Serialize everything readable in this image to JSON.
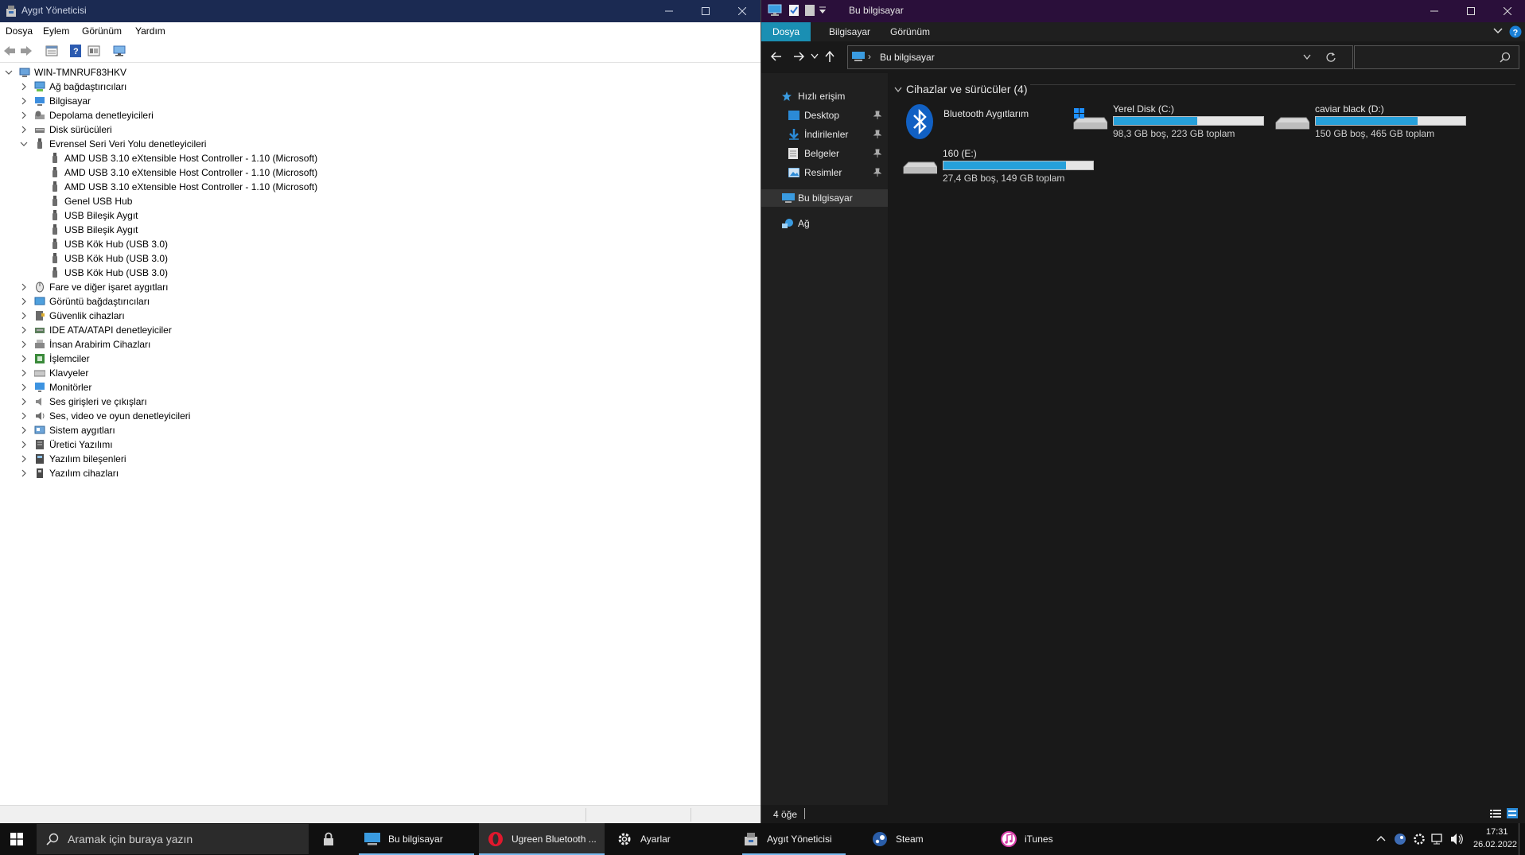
{
  "device_manager": {
    "title": "Aygıt Yöneticisi",
    "menu": [
      "Dosya",
      "Eylem",
      "Görünüm",
      "Yardım"
    ],
    "tree": {
      "root": "WIN-TMNRUF83HKV",
      "categories": [
        {
          "label": "Ağ bağdaştırıcıları",
          "icon": "network-adapter-icon"
        },
        {
          "label": "Bilgisayar",
          "icon": "computer-icon"
        },
        {
          "label": "Depolama denetleyicileri",
          "icon": "storage-controller-icon"
        },
        {
          "label": "Disk sürücüleri",
          "icon": "disk-drive-icon"
        },
        {
          "label": "Evrensel Seri Veri Yolu denetleyicileri",
          "icon": "usb-icon",
          "expanded": true,
          "children": [
            "AMD USB 3.10 eXtensible Host Controller - 1.10 (Microsoft)",
            "AMD USB 3.10 eXtensible Host Controller - 1.10 (Microsoft)",
            "AMD USB 3.10 eXtensible Host Controller - 1.10 (Microsoft)",
            "Genel USB Hub",
            "USB Bileşik Aygıt",
            "USB Bileşik Aygıt",
            "USB Kök Hub (USB 3.0)",
            "USB Kök Hub (USB 3.0)",
            "USB Kök Hub (USB 3.0)"
          ]
        },
        {
          "label": "Fare ve diğer işaret aygıtları",
          "icon": "mouse-icon"
        },
        {
          "label": "Görüntü bağdaştırıcıları",
          "icon": "display-adapter-icon"
        },
        {
          "label": "Güvenlik cihazları",
          "icon": "security-device-icon"
        },
        {
          "label": "IDE ATA/ATAPI denetleyiciler",
          "icon": "ide-controller-icon"
        },
        {
          "label": "İnsan Arabirim Cihazları",
          "icon": "hid-icon"
        },
        {
          "label": "İşlemciler",
          "icon": "processor-icon"
        },
        {
          "label": "Klavyeler",
          "icon": "keyboard-icon"
        },
        {
          "label": "Monitörler",
          "icon": "monitor-icon"
        },
        {
          "label": "Ses girişleri ve çıkışları",
          "icon": "audio-io-icon"
        },
        {
          "label": "Ses, video ve oyun denetleyicileri",
          "icon": "sound-video-icon"
        },
        {
          "label": "Sistem aygıtları",
          "icon": "system-devices-icon"
        },
        {
          "label": "Üretici Yazılımı",
          "icon": "firmware-icon"
        },
        {
          "label": "Yazılım bileşenleri",
          "icon": "software-component-icon"
        },
        {
          "label": "Yazılım cihazları",
          "icon": "software-device-icon"
        }
      ]
    }
  },
  "explorer": {
    "title": "Bu bilgisayar",
    "ribbon_tabs": [
      "Dosya",
      "Bilgisayar",
      "Görünüm"
    ],
    "address": "Bu bilgisayar",
    "sidebar": {
      "quick_access": "Hızlı erişim",
      "pinned": [
        "Desktop",
        "İndirilenler",
        "Belgeler",
        "Resimler"
      ],
      "this_pc": "Bu bilgisayar",
      "network": "Ağ"
    },
    "group_header": "Cihazlar ve sürücüler (4)",
    "bluetooth": "Bluetooth Aygıtlarım",
    "drives": [
      {
        "name": "Yerel Disk (C:)",
        "detail": "98,3 GB boş, 223 GB toplam",
        "used_fraction": 0.56
      },
      {
        "name": "caviar black (D:)",
        "detail": "150 GB boş, 465 GB toplam",
        "used_fraction": 0.68
      },
      {
        "name": "160 (E:)",
        "detail": "27,4 GB boş, 149 GB toplam",
        "used_fraction": 0.82
      }
    ],
    "status": "4 öğe"
  },
  "taskbar": {
    "search_placeholder": "Aramak için buraya yazın",
    "apps": [
      {
        "label": "Bu bilgisayar"
      },
      {
        "label": "Ugreen Bluetooth ..."
      },
      {
        "label": "Ayarlar"
      },
      {
        "label": "Aygıt Yöneticisi"
      },
      {
        "label": "Steam"
      },
      {
        "label": "iTunes"
      }
    ],
    "time": "17:31",
    "date": "26.02.2022"
  },
  "colors": {
    "dm_title_bg": "#1b2a52",
    "ex_title_bg": "#2a0f3a",
    "accent": "#1a8fb3",
    "drive_bar": "#26a0da"
  }
}
